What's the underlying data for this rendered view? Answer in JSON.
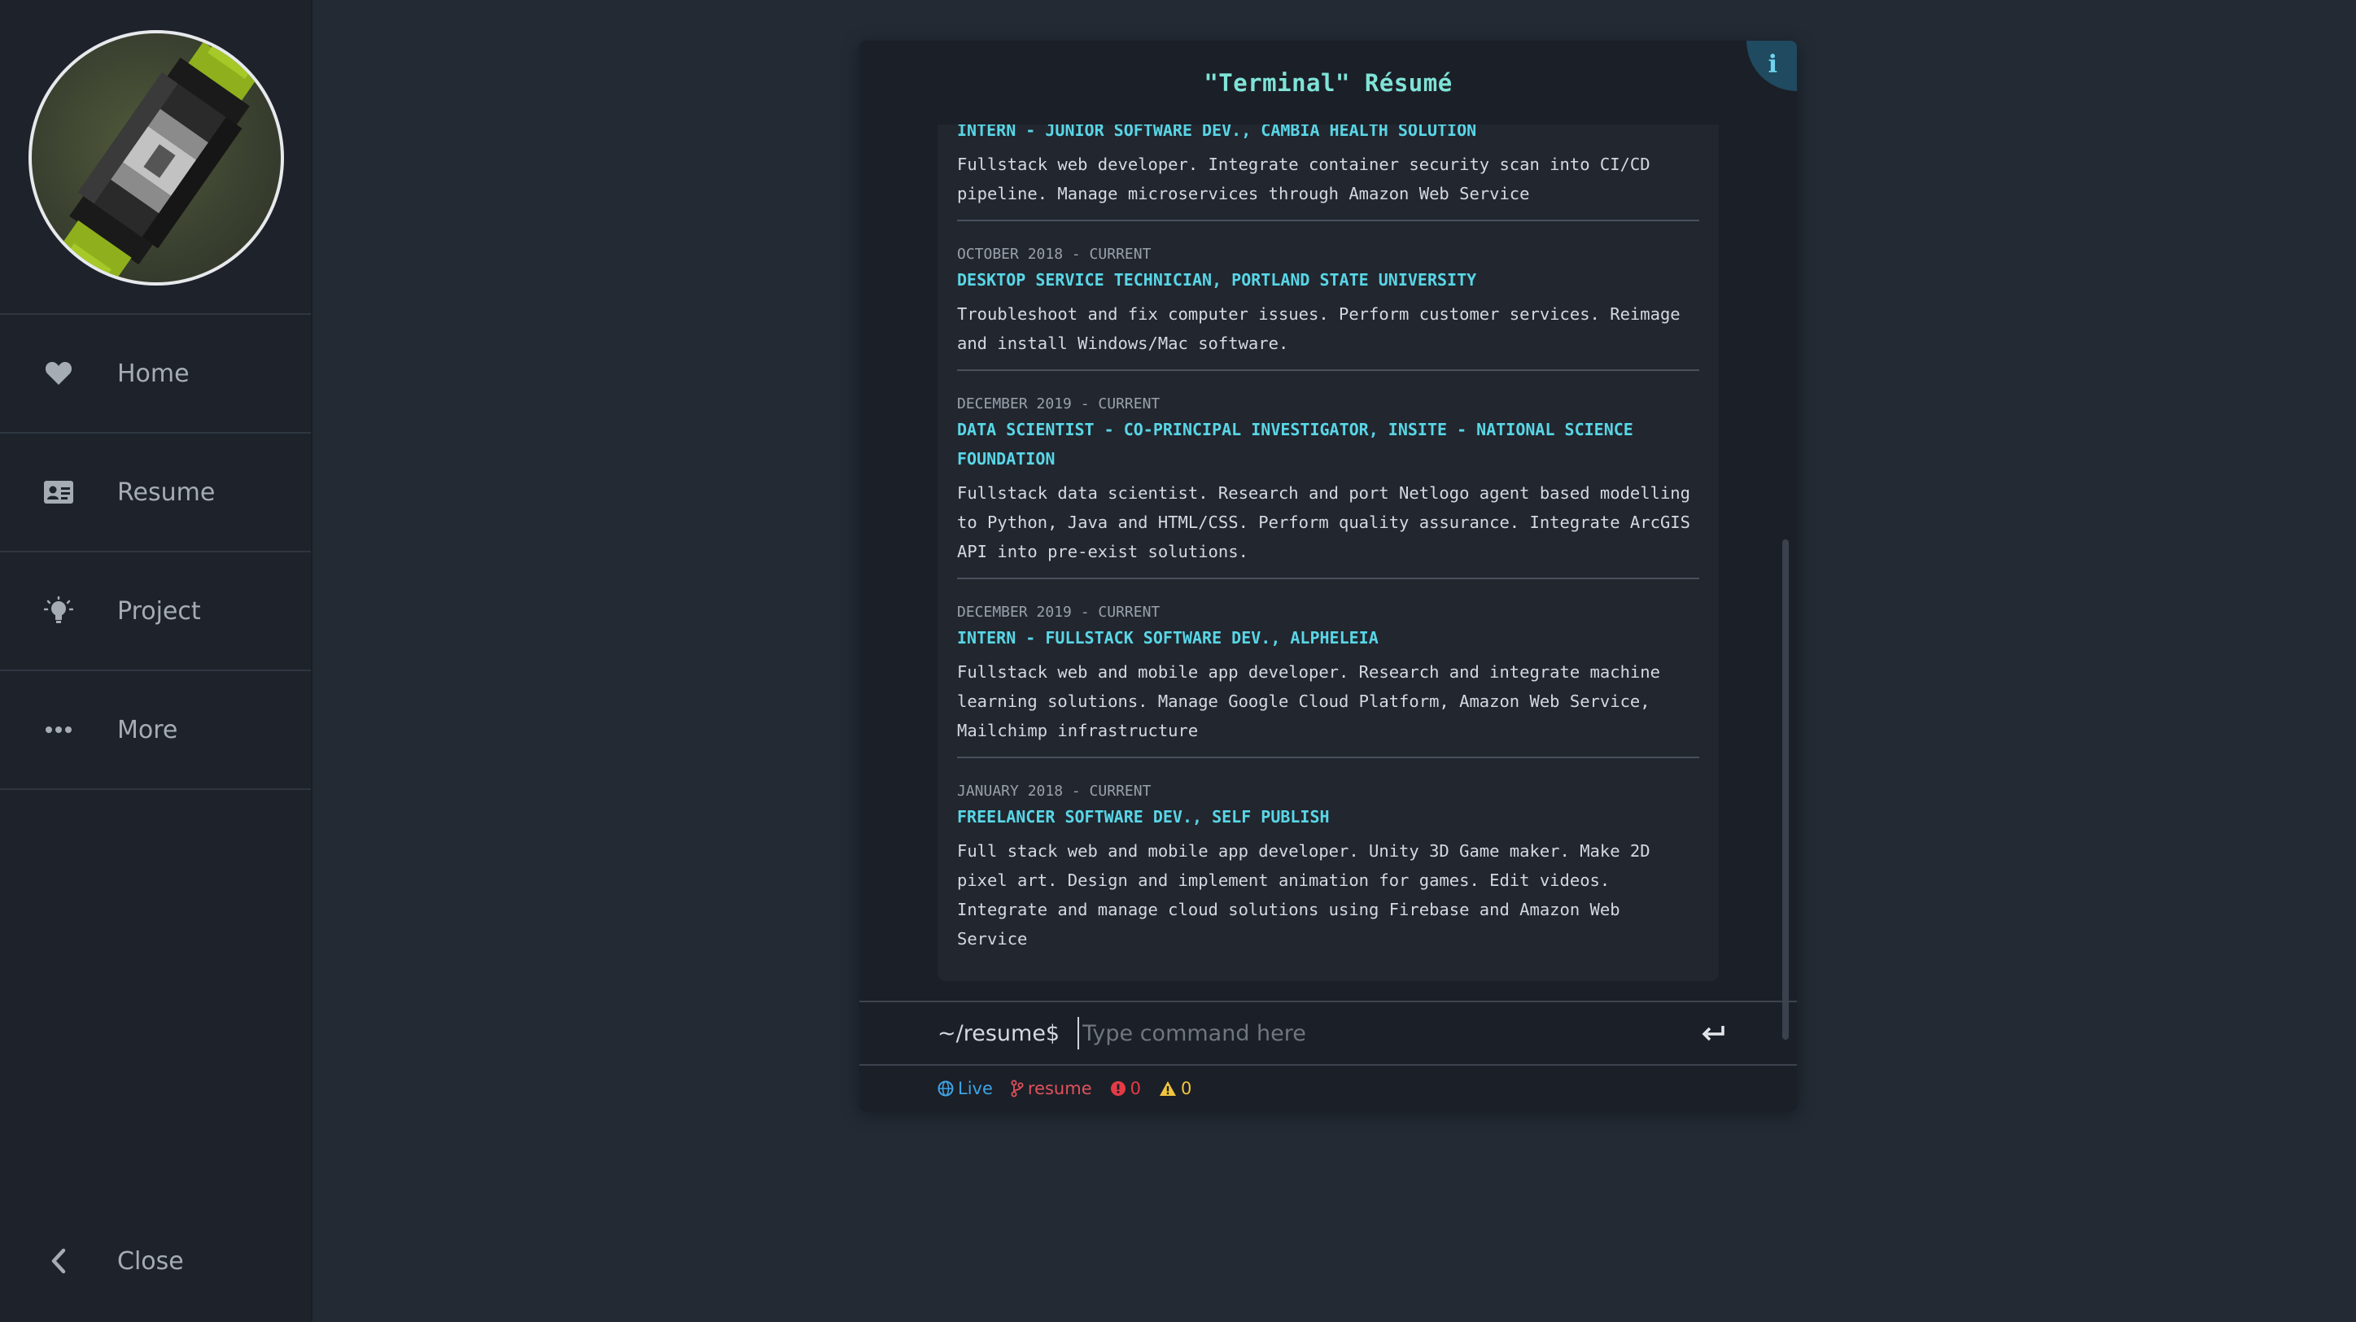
{
  "sidebar": {
    "items": [
      {
        "label": "Home",
        "icon": "heart-icon"
      },
      {
        "label": "Resume",
        "icon": "id-card-icon"
      },
      {
        "label": "Project",
        "icon": "lightbulb-icon"
      },
      {
        "label": "More",
        "icon": "ellipsis-icon"
      }
    ],
    "close_label": "Close"
  },
  "terminal": {
    "title": "\"Terminal\" Résumé",
    "info_label": "i",
    "entries": [
      {
        "date": "",
        "title": "INTERN - JUNIOR SOFTWARE DEV., CAMBIA HEALTH SOLUTION",
        "description": "Fullstack web developer. Integrate container security scan into CI/CD pipeline. Manage microservices through Amazon Web Service"
      },
      {
        "date": "OCTOBER 2018 - CURRENT",
        "title": "DESKTOP SERVICE TECHNICIAN, PORTLAND STATE UNIVERSITY",
        "description": "Troubleshoot and fix computer issues. Perform customer services. Reimage and install Windows/Mac software."
      },
      {
        "date": "DECEMBER 2019 - CURRENT",
        "title": "DATA SCIENTIST - CO-PRINCIPAL INVESTIGATOR, INSITE - NATIONAL SCIENCE FOUNDATION",
        "description": "Fullstack data scientist. Research and port Netlogo agent based modelling to Python, Java and HTML/CSS. Perform quality assurance. Integrate ArcGIS API into pre-exist solutions."
      },
      {
        "date": "DECEMBER 2019 - CURRENT",
        "title": "INTERN - FULLSTACK SOFTWARE DEV., ALPHELEIA",
        "description": "Fullstack web and mobile app developer. Research and integrate machine learning solutions. Manage Google Cloud Platform, Amazon Web Service, Mailchimp infrastructure"
      },
      {
        "date": "JANUARY 2018 - CURRENT",
        "title": "FREELANCER SOFTWARE DEV., SELF PUBLISH",
        "description": "Full stack web and mobile app developer. Unity 3D Game maker. Make 2D pixel art. Design and implement animation for games. Edit videos. Integrate and manage cloud solutions using Firebase and Amazon Web Service"
      }
    ],
    "prompt": "~/resume$",
    "input_placeholder": "Type command here",
    "input_value": ""
  },
  "status": {
    "live_label": "Live",
    "branch_label": "resume",
    "errors": "0",
    "warnings": "0"
  },
  "colors": {
    "accent": "#59d6e6",
    "title": "#7fe3d7",
    "branch": "#e0525c",
    "error": "#e53b46",
    "warning": "#f2c53d",
    "live": "#3fa3e6"
  }
}
